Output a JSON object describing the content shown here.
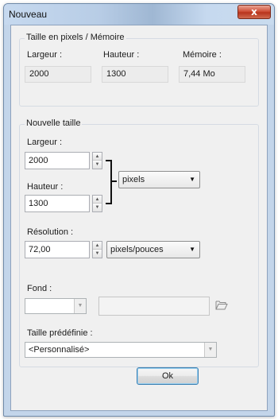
{
  "window": {
    "title": "Nouveau",
    "close_label": "x"
  },
  "memory_group": {
    "title": "Taille en pixels / Mémoire",
    "width_label": "Largeur :",
    "width_value": "2000",
    "height_label": "Hauteur :",
    "height_value": "1300",
    "memory_label": "Mémoire :",
    "memory_value": "7,44 Mo"
  },
  "new_size_group": {
    "title": "Nouvelle taille",
    "width_label": "Largeur :",
    "width_value": "2000",
    "height_label": "Hauteur :",
    "height_value": "1300",
    "unit_select": "pixels",
    "resolution_label": "Résolution :",
    "resolution_value": "72,00",
    "resolution_unit_select": "pixels/pouces",
    "background_label": "Fond :",
    "preset_label": "Taille prédéfinie :",
    "preset_select": "<Personnalisé>"
  },
  "ok_button": "Ok",
  "icons": {
    "folder": "folder-open-icon",
    "dropdown": "chevron-down-icon",
    "spin_up": "arrow-up-icon",
    "spin_down": "arrow-down-icon"
  }
}
